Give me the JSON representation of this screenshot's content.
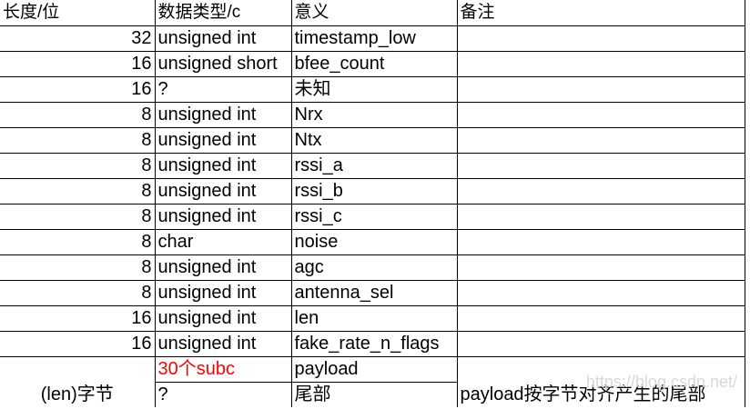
{
  "header": [
    "长度/位",
    "数据类型/c",
    "意义",
    "备注"
  ],
  "rows": [
    {
      "length": "32",
      "type": "unsigned int",
      "meaning": "timestamp_low",
      "note": ""
    },
    {
      "length": "16",
      "type": "unsigned short",
      "meaning": "bfee_count",
      "note": ""
    },
    {
      "length": "16",
      "type": "?",
      "meaning": "未知",
      "note": ""
    },
    {
      "length": "8",
      "type": "unsigned int",
      "meaning": "Nrx",
      "note": ""
    },
    {
      "length": "8",
      "type": "unsigned int",
      "meaning": "Ntx",
      "note": ""
    },
    {
      "length": "8",
      "type": "unsigned int",
      "meaning": "rssi_a",
      "note": ""
    },
    {
      "length": "8",
      "type": "unsigned int",
      "meaning": "rssi_b",
      "note": ""
    },
    {
      "length": "8",
      "type": "unsigned int",
      "meaning": "rssi_c",
      "note": ""
    },
    {
      "length": "8",
      "type": "char",
      "meaning": "noise",
      "note": ""
    },
    {
      "length": "8",
      "type": "unsigned int",
      "meaning": "agc",
      "note": ""
    },
    {
      "length": "8",
      "type": "unsigned int",
      "meaning": "antenna_sel",
      "note": ""
    },
    {
      "length": "16",
      "type": "unsigned int",
      "meaning": "len",
      "note": ""
    },
    {
      "length": "16",
      "type": "unsigned int",
      "meaning": "fake_rate_n_flags",
      "note": ""
    },
    {
      "length": "",
      "type": "30个subc",
      "meaning": "payload",
      "note": ""
    },
    {
      "length": "(len)字节",
      "type": "?",
      "meaning": "尾部",
      "note": "payload按字节对齐产生的尾部"
    }
  ],
  "colors": {
    "highlight": "#ff0000",
    "border": "#000000",
    "background": "#ffffff"
  },
  "watermark": "https://blog.csdn.net/"
}
